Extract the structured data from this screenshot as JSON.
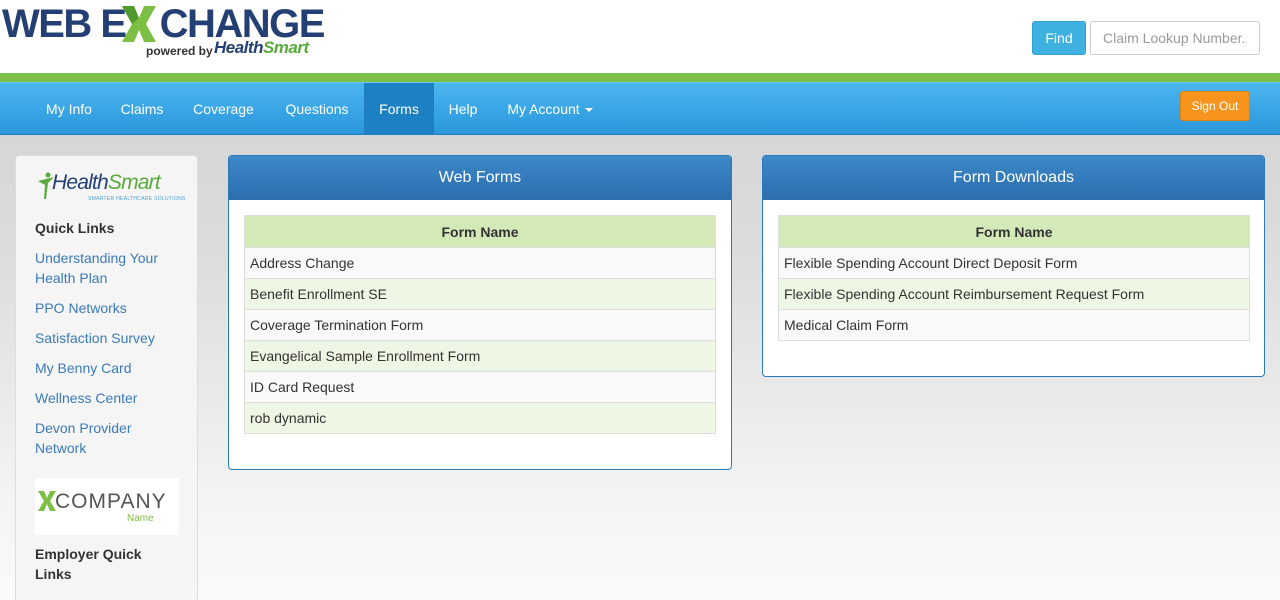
{
  "brand": {
    "logo_main_left": "WEB E",
    "logo_main_right": "CHANGE",
    "logo_powered_by": "powered by",
    "logo_partner_a": "Health",
    "logo_partner_b": "Smart"
  },
  "header": {
    "find_label": "Find",
    "claim_placeholder": "Claim Lookup Number.."
  },
  "nav": {
    "items": [
      {
        "label": "My Info"
      },
      {
        "label": "Claims"
      },
      {
        "label": "Coverage"
      },
      {
        "label": "Questions"
      },
      {
        "label": "Forms"
      },
      {
        "label": "Help"
      },
      {
        "label": "My Account"
      }
    ],
    "active": "Forms",
    "signout_label": "Sign Out"
  },
  "sidebar": {
    "partner_logo_a": "Health",
    "partner_logo_b": "Smart",
    "partner_tagline": "SMARTER HEALTHCARE SOLUTIONS",
    "quick_links_heading": "Quick Links",
    "quick_links": [
      {
        "label": "Understanding Your Health Plan"
      },
      {
        "label": "PPO Networks"
      },
      {
        "label": "Satisfaction Survey"
      },
      {
        "label": "My Benny Card"
      },
      {
        "label": "Wellness Center"
      },
      {
        "label": "Devon Provider Network"
      }
    ],
    "company_logo_text": "COMPANY",
    "company_logo_sub": "Name",
    "employer_heading": "Employer Quick Links"
  },
  "web_forms": {
    "title": "Web Forms",
    "column_header": "Form Name",
    "rows": [
      "Address Change",
      "Benefit Enrollment SE",
      "Coverage Termination Form",
      "Evangelical Sample Enrollment Form",
      "ID Card Request",
      "rob dynamic"
    ]
  },
  "form_downloads": {
    "title": "Form Downloads",
    "column_header": "Form Name",
    "rows": [
      "Flexible Spending Account Direct Deposit Form",
      "Flexible Spending Account Reimbursement Request Form",
      "Medical Claim Form"
    ]
  },
  "colors": {
    "accent_green": "#7dbf44",
    "nav_blue": "#2a97dd",
    "signout_orange": "#f7941d",
    "find_blue": "#3eb1e0",
    "link_blue": "#3a7ab8"
  }
}
